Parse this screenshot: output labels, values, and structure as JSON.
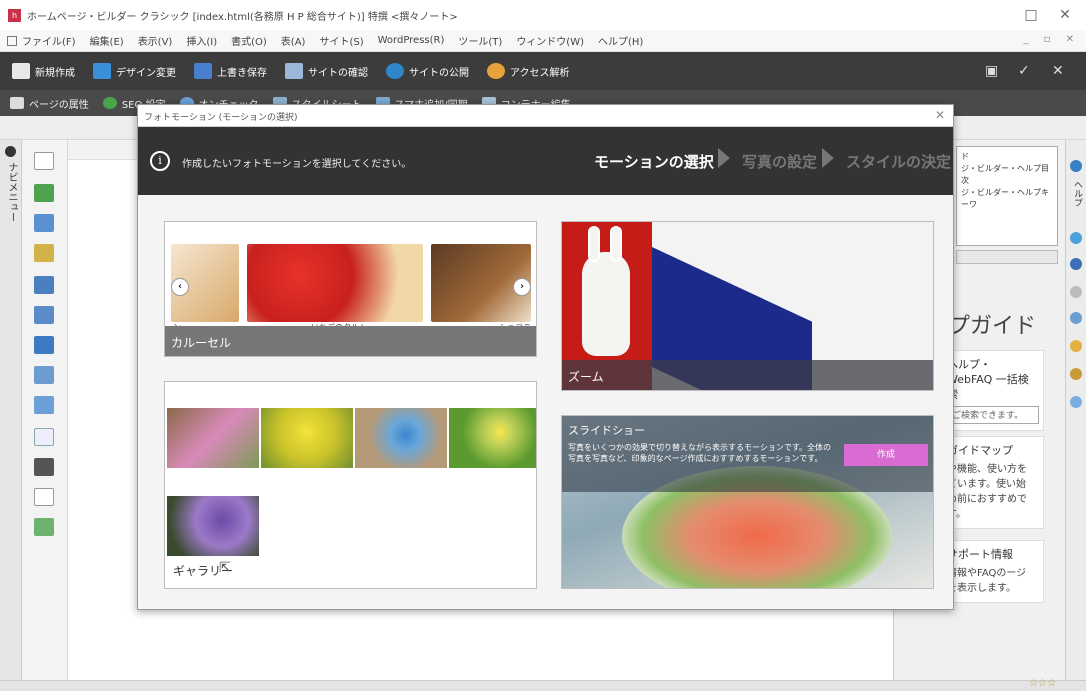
{
  "window": {
    "title": "ホームページ・ビルダー クラシック [index.html(各務原 H P 総合サイト)] 特撰 <撰々ノート>",
    "app_icon_text": "h"
  },
  "menu": {
    "items": [
      "ファイル(F)",
      "編集(E)",
      "表示(V)",
      "挿入(I)",
      "書式(O)",
      "表(A)",
      "サイト(S)",
      "WordPress(R)",
      "ツール(T)",
      "ウィンドウ(W)",
      "ヘルプ(H)"
    ]
  },
  "toolbar": {
    "buttons": [
      "新規作成",
      "デザイン変更",
      "上書き保存",
      "サイトの確認",
      "サイトの公開",
      "アクセス解析"
    ],
    "secondary": [
      "ページの属性",
      "SEO 設定",
      "オンチェック",
      "スタイルシート",
      "スマホ追加/同期",
      "コンテナー編集"
    ]
  },
  "colors": {
    "toolbar_bg": "#3c3c3c",
    "dialog_header_bg": "#333333",
    "caption_bar": "#777777",
    "create_button": "#d96bd3"
  },
  "left_panel": {
    "label": "ナビメニュー"
  },
  "right_panel": {
    "list_items": [
      "ド",
      "ジ・ビルダー・ヘルプ目次",
      "ジ・ビルダー・ヘルプキーワ"
    ],
    "guide_title": "プガイド",
    "help_card": {
      "title": "ヘルプ・WebFAQ 一括検索",
      "search_placeholder": "ご検索できます。"
    },
    "guide_map": {
      "title": "ガイドマップ",
      "body": "や機能、使い方をています。使い始め前におすすめです。"
    },
    "support": {
      "title": "サポート情報",
      "body": "情報やFAQのージを表示します。"
    },
    "far_right_label": "ヘルプ"
  },
  "dialog": {
    "title": "フォトモーション (モーションの選択)",
    "instruction": "作成したいフォトモーションを選択してください。",
    "steps": [
      "モーションの選択",
      "写真の設定",
      "スタイルの決定"
    ],
    "active_step": 0,
    "motions": {
      "carousel": {
        "label": "カルーセル",
        "item_labels": [
          "ン",
          "いちごのタルト",
          "ショコラ"
        ]
      },
      "zoom": {
        "label": "ズーム"
      },
      "gallery": {
        "label": "ギャラリー"
      },
      "slideshow": {
        "label": "スライドショー",
        "description": "写真をいくつかの効果で切り替えながら表示するモーションです。全体の写真を写真など、印象的なページ作成におすすめするモーションです。",
        "create_button": "作成"
      }
    }
  },
  "statusbar": {
    "rating": "☆☆☆"
  }
}
